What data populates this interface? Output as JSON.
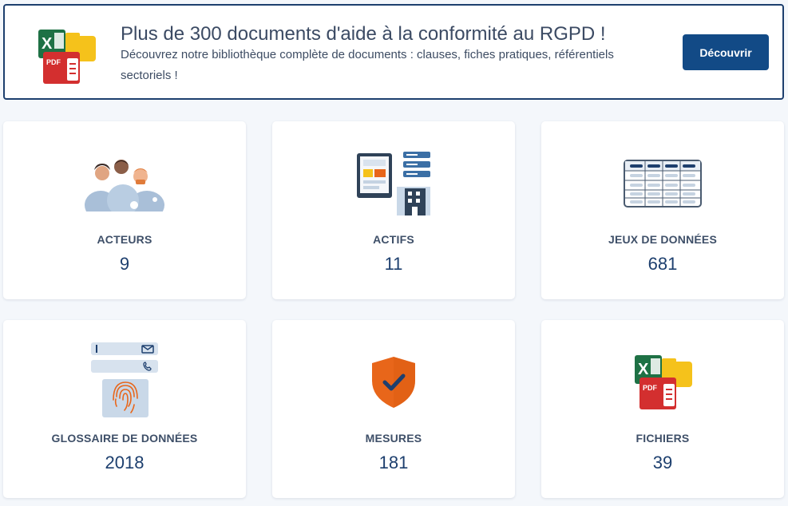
{
  "banner": {
    "title": "Plus de 300 documents d'aide à la conformité au RGPD !",
    "description": "Découvrez notre bibliothèque complète de documents : clauses, fiches pratiques, référentiels sectoriels !",
    "button_label": "Découvrir",
    "icon": "documents-files-icon",
    "icon_label": "PDF"
  },
  "cards": [
    {
      "label": "ACTEURS",
      "count": "9",
      "icon": "people-group-icon"
    },
    {
      "label": "ACTIFS",
      "count": "11",
      "icon": "devices-building-icon"
    },
    {
      "label": "JEUX DE DONNÉES",
      "count": "681",
      "icon": "data-table-icon"
    },
    {
      "label": "GLOSSAIRE DE DONNÉES",
      "count": "2018",
      "icon": "personal-data-icon"
    },
    {
      "label": "MESURES",
      "count": "181",
      "icon": "shield-check-icon"
    },
    {
      "label": "FICHIERS",
      "count": "39",
      "icon": "documents-files-icon",
      "icon_label": "PDF"
    }
  ],
  "colors": {
    "primary": "#124a86",
    "border": "#1d3f6e",
    "shield": "#e8661a",
    "excel": "#1e7145",
    "pdf": "#d32f2f",
    "folder": "#f5c21b"
  }
}
